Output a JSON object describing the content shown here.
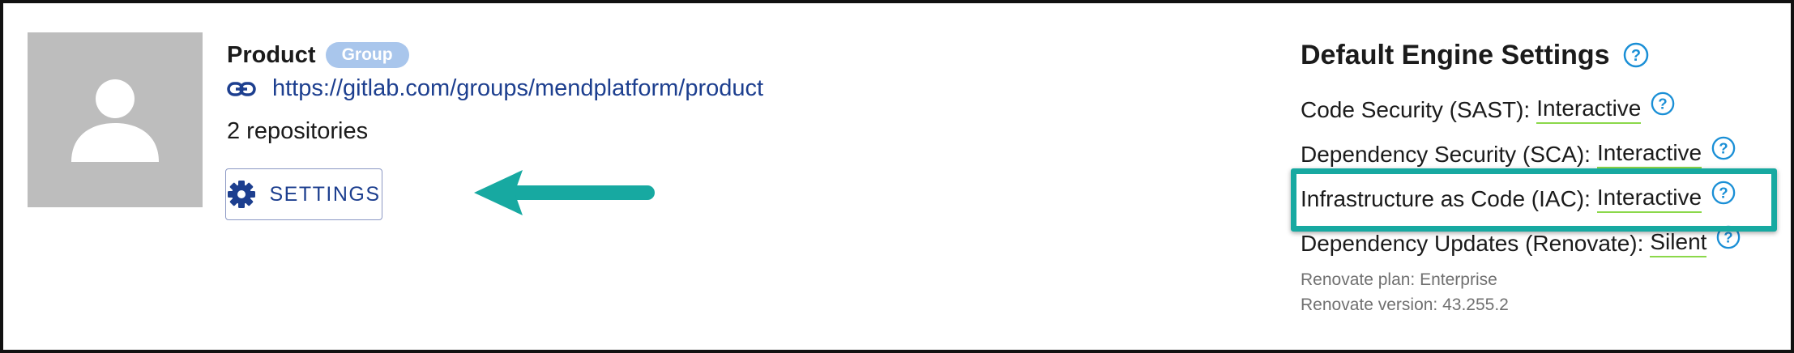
{
  "group": {
    "name": "Product",
    "badge": "Group",
    "url": "https://gitlab.com/groups/mendplatform/product",
    "repo_count_text": "2 repositories",
    "settings_label": "SETTINGS"
  },
  "engine_settings": {
    "title": "Default Engine Settings",
    "rows": [
      {
        "label": "Code Security (SAST):",
        "value": "Interactive"
      },
      {
        "label": "Dependency Security (SCA):",
        "value": "Interactive"
      },
      {
        "label": "Infrastructure as Code (IAC):",
        "value": "Interactive"
      },
      {
        "label": "Dependency Updates (Renovate):",
        "value": "Silent"
      }
    ],
    "renovate_plan": "Renovate plan: Enterprise",
    "renovate_version": "Renovate version: 43.255.2"
  },
  "colors": {
    "accent_teal": "#17a9a1",
    "link_blue": "#1d3f8f",
    "help_icon_blue": "#1a8fd6",
    "underline_green": "#8bd84a",
    "badge_bg": "#a9c6ec",
    "avatar_bg": "#bdbdbd"
  },
  "icons": [
    "user-avatar-icon",
    "link-icon",
    "gear-icon",
    "help-icon",
    "annotation-arrow"
  ]
}
